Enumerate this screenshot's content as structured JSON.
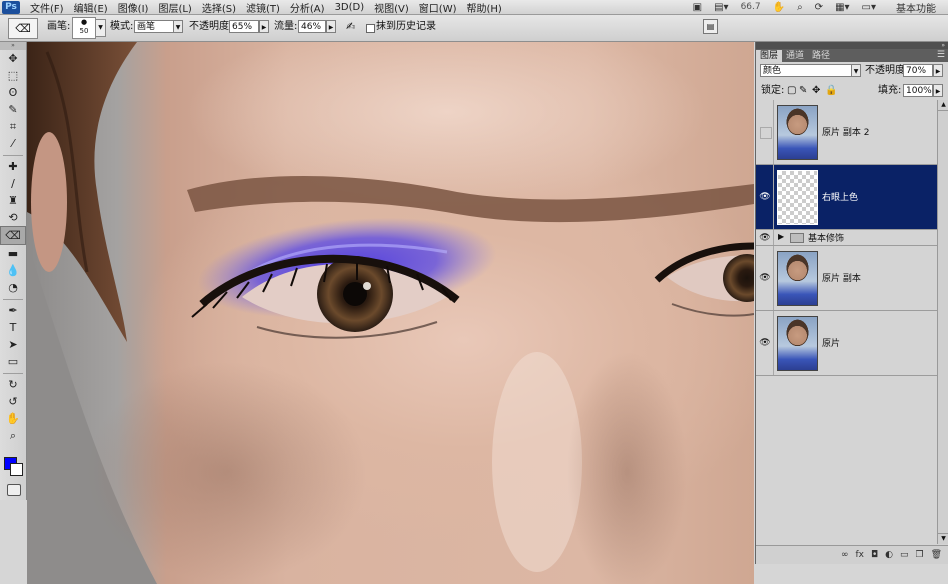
{
  "menubar": {
    "logo": "Ps",
    "items": [
      "文件(F)",
      "编辑(E)",
      "图像(I)",
      "图层(L)",
      "选择(S)",
      "滤镜(T)",
      "分析(A)",
      "3D(D)",
      "视图(V)",
      "窗口(W)",
      "帮助(H)"
    ],
    "zoom": "66.7",
    "workspace": "基本功能"
  },
  "options": {
    "brush_label": "画笔:",
    "brush_size": "50",
    "mode_label": "模式:",
    "mode_value": "画笔",
    "opacity_label": "不透明度:",
    "opacity_value": "65%",
    "flow_label": "流量:",
    "flow_value": "46%",
    "history_label": "抹到历史记录"
  },
  "toolbox": {
    "tools": [
      "move-icon",
      "marquee-icon",
      "lasso-icon",
      "quick-select-icon",
      "crop-icon",
      "eyedropper-icon",
      "healing-icon",
      "brush-icon",
      "clone-stamp-icon",
      "history-brush-icon",
      "eraser-icon",
      "gradient-icon",
      "blur-icon",
      "dodge-icon",
      "pen-icon",
      "type-icon",
      "path-select-icon",
      "shape-icon",
      "rotate-3d-icon",
      "orbit-3d-icon",
      "hand-icon",
      "zoom-icon"
    ],
    "active_tool": "eraser-icon",
    "foreground_color": "#0000ff",
    "background_color": "#ffffff"
  },
  "layers_panel": {
    "tabs": [
      "图层",
      "通道",
      "路径"
    ],
    "active_tab": "图层",
    "blend_mode": "颜色",
    "opacity_label": "不透明度:",
    "opacity_value": "70%",
    "lock_label": "锁定:",
    "fill_label": "填充:",
    "fill_value": "100%",
    "layers": [
      {
        "name": "原片 副本 2",
        "visible": false,
        "thumb": "photo",
        "selected": false
      },
      {
        "name": "右眼上色",
        "visible": true,
        "thumb": "transparent",
        "selected": true
      },
      {
        "name": "基本修饰",
        "visible": true,
        "type": "group"
      },
      {
        "name": "原片 副本",
        "visible": true,
        "thumb": "photo",
        "selected": false
      },
      {
        "name": "原片",
        "visible": true,
        "thumb": "photo",
        "selected": false
      }
    ]
  },
  "colors": {
    "selected_layer": "#0a2266",
    "eyeshadow": "#4a38e0"
  }
}
